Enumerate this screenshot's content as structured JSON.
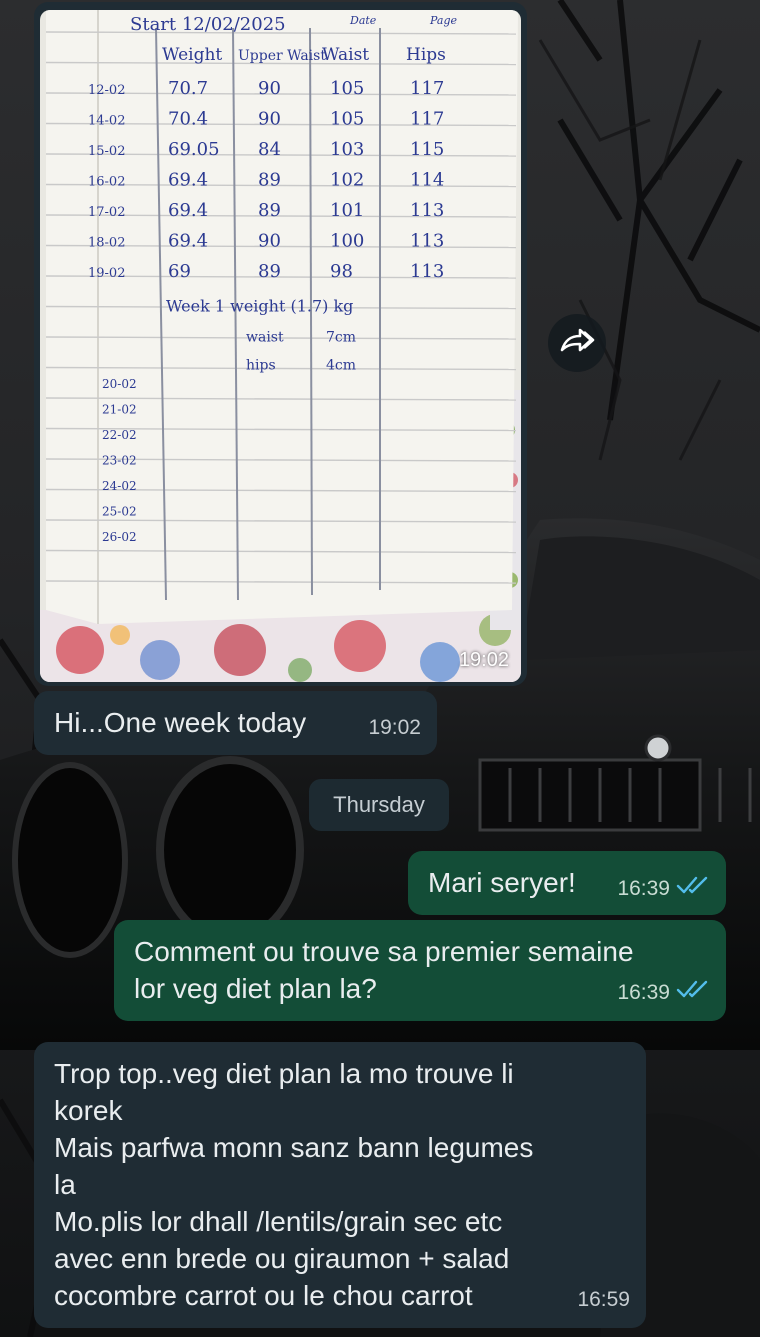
{
  "chat": {
    "image_message": {
      "time": "19:02",
      "notebook": {
        "header": "Start 12/02/2025",
        "header_labels": [
          "Date",
          "Page"
        ],
        "columns": [
          "Weight",
          "Upper Waist",
          "Waist",
          "Hips"
        ],
        "rows": [
          {
            "date": "12-02",
            "weight": "70.7",
            "upper_waist": "90",
            "waist": "105",
            "hips": "117"
          },
          {
            "date": "14-02",
            "weight": "70.4",
            "upper_waist": "90",
            "waist": "105",
            "hips": "117"
          },
          {
            "date": "15-02",
            "weight": "69.05",
            "upper_waist": "84",
            "waist": "103",
            "hips": "115"
          },
          {
            "date": "16-02",
            "weight": "69.4",
            "upper_waist": "89",
            "waist": "102",
            "hips": "114"
          },
          {
            "date": "17-02",
            "weight": "69.4",
            "upper_waist": "89",
            "waist": "101",
            "hips": "113"
          },
          {
            "date": "18-02",
            "weight": "69.4",
            "upper_waist": "90",
            "waist": "100",
            "hips": "113"
          },
          {
            "date": "19-02",
            "weight": "69",
            "upper_waist": "89",
            "waist": "98",
            "hips": "113"
          }
        ],
        "summary_title": "Week 1 weight (1.7) kg",
        "summary": [
          {
            "label": "waist",
            "value": "7cm"
          },
          {
            "label": "hips",
            "value": "4cm"
          }
        ],
        "future_dates": [
          "20-02",
          "21-02",
          "22-02",
          "23-02",
          "24-02",
          "25-02",
          "26-02"
        ]
      }
    },
    "messages": [
      {
        "id": "m1",
        "direction": "in",
        "text": "Hi...One week today",
        "time": "19:02"
      },
      {
        "id": "m2",
        "direction": "out",
        "text": "Mari seryer!",
        "time": "16:39",
        "status": "read"
      },
      {
        "id": "m3",
        "direction": "out",
        "text": "Comment ou trouve sa premier semaine\nlor veg diet plan la?",
        "time": "16:39",
        "status": "read"
      },
      {
        "id": "m4",
        "direction": "in",
        "text": "Trop top..veg diet plan la mo trouve li\nkorek\nMais parfwa monn sanz bann legumes\nla\nMo.plis lor dhall /lentils/grain sec etc\navec enn brede ou giraumon + salad\ncocombre carrot ou le chou carrot",
        "time": "16:59"
      }
    ],
    "date_divider": "Thursday",
    "colors": {
      "incoming": "#1f2c34",
      "outgoing": "#134d37",
      "read_ticks": "#53bdeb",
      "text": "#e9edef"
    },
    "icons": {
      "forward": "forward-icon",
      "read": "double-check-icon"
    }
  }
}
